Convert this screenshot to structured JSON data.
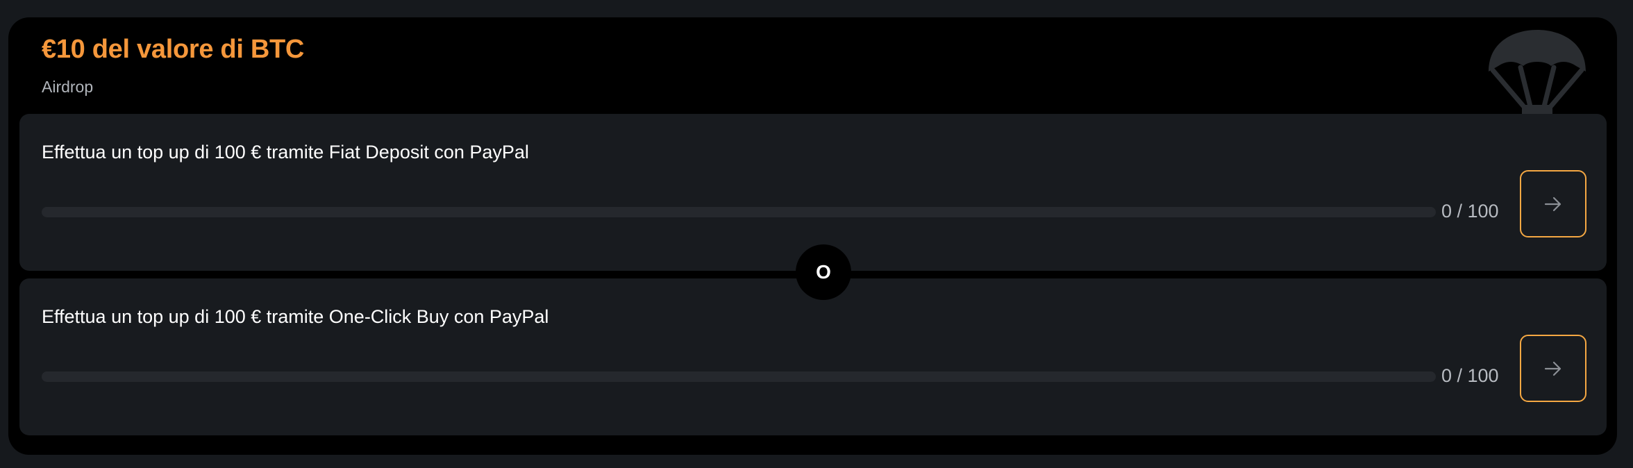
{
  "reward": {
    "title": "€10 del valore di BTC",
    "subtitle": "Airdrop",
    "icon": "parachute-icon"
  },
  "tasks": [
    {
      "label": "Effettua un top up di 100 € tramite Fiat Deposit con PayPal",
      "progress_text": "0 / 100",
      "progress_value": 0,
      "progress_max": 100,
      "action_icon": "arrow-right-icon"
    },
    {
      "label": "Effettua un top up di 100 € tramite One-Click Buy con PayPal",
      "progress_text": "0 / 100",
      "progress_value": 0,
      "progress_max": 100,
      "action_icon": "arrow-right-icon"
    }
  ],
  "separator": {
    "label": "O"
  },
  "colors": {
    "accent": "#f5973b",
    "button_border": "#f5a843",
    "card_bg": "#000000",
    "task_bg": "#181b1f",
    "page_bg": "#16191d"
  }
}
